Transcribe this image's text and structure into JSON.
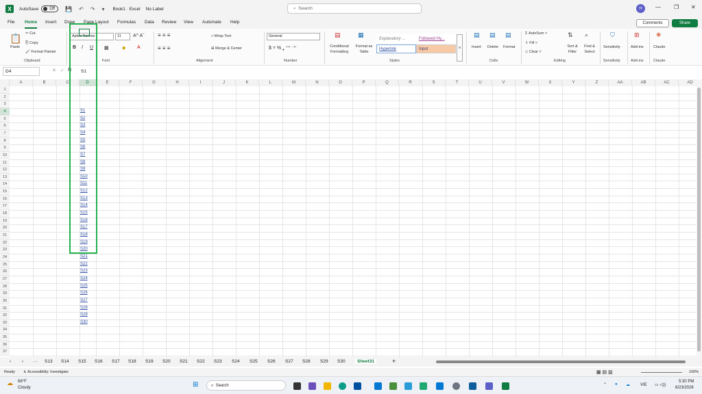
{
  "title": {
    "autosave": "AutoSave",
    "toggle": "Off",
    "doc": "Book1 · Excel",
    "label": "No Label",
    "search_placeholder": "Search",
    "avatar": "H"
  },
  "tabs": [
    "File",
    "Home",
    "Insert",
    "Draw",
    "Page Layout",
    "Formulas",
    "Data",
    "Review",
    "View",
    "Automate",
    "Help"
  ],
  "buttons": {
    "comments": "Comments",
    "share": "Share"
  },
  "ribbon": {
    "clipboard": {
      "paste": "Paste",
      "cut": "Cut",
      "copy": "Copy",
      "painter": "Format Painter",
      "group": "Clipboard"
    },
    "font": {
      "name": "Aptos Narrow",
      "size": "11",
      "group": "Font"
    },
    "alignment": {
      "wrap": "Wrap Text",
      "merge": "Merge & Center",
      "group": "Alignment"
    },
    "number": {
      "format": "General",
      "group": "Number"
    },
    "styles": {
      "conditional": "Conditional Formatting",
      "formatTable": "Format as Table",
      "explanatory": "Explanatory ...",
      "followed": "Followed Hy...",
      "hyperlink": "Hyperlink",
      "input": "Input",
      "group": "Styles"
    },
    "cells": {
      "insert": "Insert",
      "delete": "Delete",
      "format": "Format",
      "group": "Cells"
    },
    "editing": {
      "autosum": "AutoSum",
      "fill": "Fill",
      "clear": "Clear",
      "sort": "Sort & Filter",
      "find": "Find & Select",
      "group": "Editing"
    },
    "sensitivity": {
      "label": "Sensitivity",
      "group": "Sensitivity"
    },
    "addins": {
      "label": "Add-ins",
      "group": "Add-ins"
    },
    "claude": {
      "label": "Claude",
      "group": "Claude"
    }
  },
  "formula": {
    "cell": "D4",
    "fx": "fx",
    "value": "S1"
  },
  "columns": [
    "A",
    "B",
    "C",
    "D",
    "E",
    "F",
    "G",
    "H",
    "I",
    "J",
    "K",
    "L",
    "M",
    "N",
    "O",
    "P",
    "Q",
    "R",
    "S",
    "T",
    "U",
    "V",
    "W",
    "X",
    "Y",
    "Z",
    "AA",
    "AB",
    "AC",
    "AD"
  ],
  "rows": 37,
  "cells_D": [
    "S1",
    "S2",
    "S3",
    "S4",
    "S5",
    "S6",
    "S7",
    "S8",
    "S9",
    "S10",
    "S11",
    "S12",
    "S13",
    "S14",
    "S15",
    "S16",
    "S17",
    "S18",
    "S19",
    "S20",
    "S21",
    "S22",
    "S23",
    "S24",
    "S25",
    "S26",
    "S27",
    "S28",
    "S29",
    "S30"
  ],
  "sheets": [
    "S13",
    "S14",
    "S15",
    "S16",
    "S17",
    "S18",
    "S19",
    "S20",
    "S21",
    "S22",
    "S23",
    "S24",
    "S25",
    "S26",
    "S27",
    "S28",
    "S29",
    "S30",
    "Sheet31"
  ],
  "status": {
    "ready": "Ready",
    "access": "Accessibility: Investigate",
    "zoom": "100%"
  },
  "taskbar": {
    "temp": "68°F",
    "weather": "Cloudy",
    "search": "Search",
    "lang": "VIE",
    "time": "5:30 PM",
    "date": "6/23/2026"
  }
}
